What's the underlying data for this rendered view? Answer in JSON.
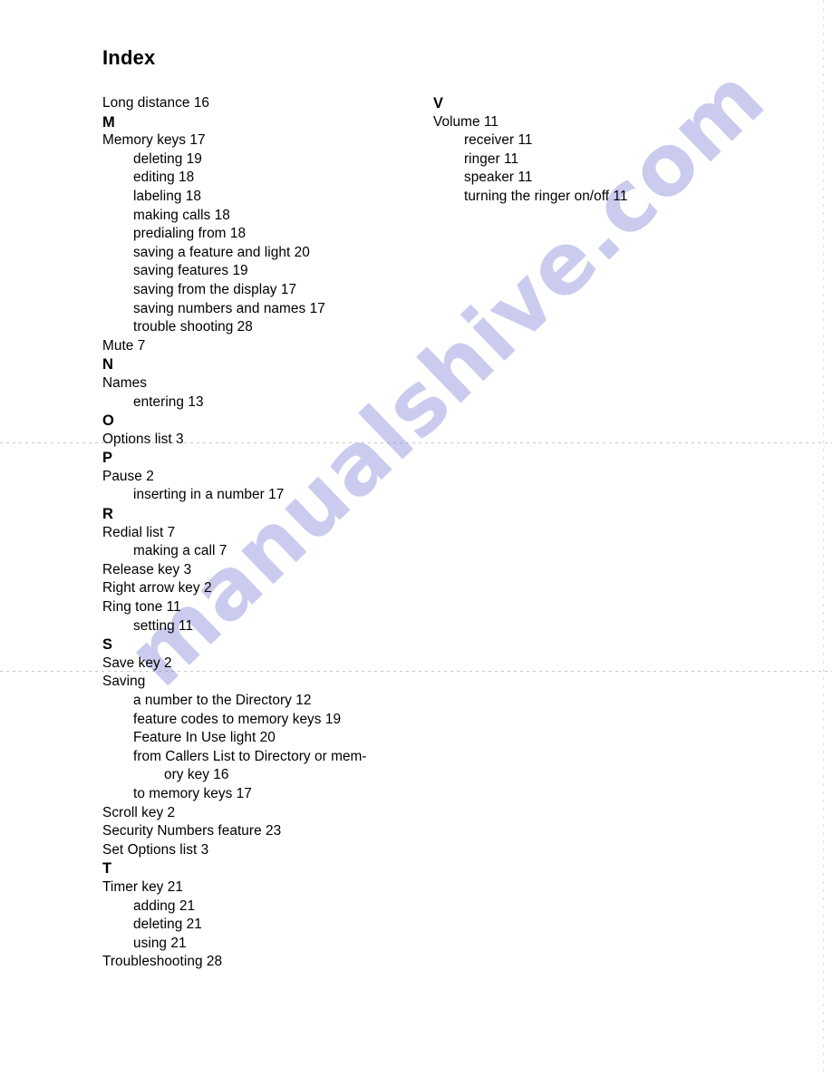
{
  "document": {
    "title": "Index",
    "watermark": "manualshive.com",
    "watermark_color": "#c9c9ef",
    "background_color": "#ffffff",
    "text_color": "#000000"
  },
  "columns": {
    "left": [
      {
        "text": "Long distance 16",
        "level": 0,
        "section": false
      },
      {
        "text": "M",
        "level": 0,
        "section": true
      },
      {
        "text": "Memory keys 17",
        "level": 0,
        "section": false
      },
      {
        "text": "deleting 19",
        "level": 1,
        "section": false
      },
      {
        "text": "editing 18",
        "level": 1,
        "section": false
      },
      {
        "text": "labeling 18",
        "level": 1,
        "section": false
      },
      {
        "text": "making calls 18",
        "level": 1,
        "section": false
      },
      {
        "text": "predialing from 18",
        "level": 1,
        "section": false
      },
      {
        "text": "saving a feature and light 20",
        "level": 1,
        "section": false
      },
      {
        "text": "saving features 19",
        "level": 1,
        "section": false
      },
      {
        "text": "saving from the display 17",
        "level": 1,
        "section": false
      },
      {
        "text": "saving numbers and names 17",
        "level": 1,
        "section": false
      },
      {
        "text": "trouble shooting 28",
        "level": 1,
        "section": false
      },
      {
        "text": "Mute 7",
        "level": 0,
        "section": false
      },
      {
        "text": "N",
        "level": 0,
        "section": true
      },
      {
        "text": "Names",
        "level": 0,
        "section": false
      },
      {
        "text": "entering 13",
        "level": 1,
        "section": false
      },
      {
        "text": "O",
        "level": 0,
        "section": true
      },
      {
        "text": "Options list 3",
        "level": 0,
        "section": false
      },
      {
        "text": "P",
        "level": 0,
        "section": true
      },
      {
        "text": "Pause 2",
        "level": 0,
        "section": false
      },
      {
        "text": "inserting in a number 17",
        "level": 1,
        "section": false
      },
      {
        "text": "R",
        "level": 0,
        "section": true
      },
      {
        "text": "Redial list 7",
        "level": 0,
        "section": false
      },
      {
        "text": "making a call 7",
        "level": 1,
        "section": false
      },
      {
        "text": "Release key 3",
        "level": 0,
        "section": false
      },
      {
        "text": "Right arrow key 2",
        "level": 0,
        "section": false
      },
      {
        "text": "Ring tone 11",
        "level": 0,
        "section": false
      },
      {
        "text": "setting 11",
        "level": 1,
        "section": false
      },
      {
        "text": "S",
        "level": 0,
        "section": true
      },
      {
        "text": "Save key 2",
        "level": 0,
        "section": false
      },
      {
        "text": "Saving",
        "level": 0,
        "section": false
      },
      {
        "text": "a number to the Directory 12",
        "level": 1,
        "section": false
      },
      {
        "text": "feature codes to memory keys 19",
        "level": 1,
        "section": false
      },
      {
        "text": "Feature In Use light 20",
        "level": 1,
        "section": false
      },
      {
        "text": "from Callers List to Directory or mem-",
        "level": 1,
        "section": false
      },
      {
        "text": "ory key 16",
        "level": 2,
        "section": false
      },
      {
        "text": "to memory keys 17",
        "level": 1,
        "section": false
      },
      {
        "text": "Scroll key 2",
        "level": 0,
        "section": false
      },
      {
        "text": "Security Numbers feature 23",
        "level": 0,
        "section": false
      },
      {
        "text": "Set Options list 3",
        "level": 0,
        "section": false
      },
      {
        "text": "T",
        "level": 0,
        "section": true
      },
      {
        "text": "Timer key 21",
        "level": 0,
        "section": false
      },
      {
        "text": "adding 21",
        "level": 1,
        "section": false
      },
      {
        "text": "deleting 21",
        "level": 1,
        "section": false
      },
      {
        "text": "using 21",
        "level": 1,
        "section": false
      },
      {
        "text": "Troubleshooting 28",
        "level": 0,
        "section": false
      }
    ],
    "right": [
      {
        "text": "V",
        "level": 0,
        "section": true
      },
      {
        "text": "Volume 11",
        "level": 0,
        "section": false
      },
      {
        "text": "receiver 11",
        "level": 1,
        "section": false
      },
      {
        "text": "ringer 11",
        "level": 1,
        "section": false
      },
      {
        "text": "speaker 11",
        "level": 1,
        "section": false
      },
      {
        "text": "turning the ringer on/off 11",
        "level": 1,
        "section": false
      }
    ]
  }
}
